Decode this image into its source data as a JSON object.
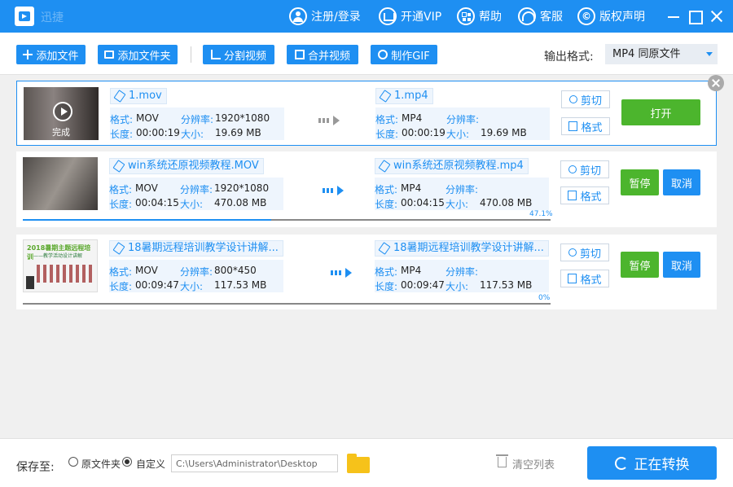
{
  "app": {
    "title": "迅捷"
  },
  "titlebar": {
    "items": [
      {
        "label": "注册/登录"
      },
      {
        "label": "开通VIP"
      },
      {
        "label": "帮助"
      },
      {
        "label": "客服"
      },
      {
        "label": "版权声明"
      }
    ]
  },
  "toolbar": {
    "add_file": "添加文件",
    "add_folder": "添加文件夹",
    "split_video": "分割视频",
    "merge_video": "合并视频",
    "make_gif": "制作GIF",
    "output_label": "输出格式:",
    "output_value": "MP4  同原文件"
  },
  "labels": {
    "format": "格式:",
    "resolution": "分辨率:",
    "duration": "长度:",
    "size": "大小:",
    "cut": "剪切",
    "format_btn": "格式",
    "done": "完成"
  },
  "files": [
    {
      "src_name": "1.mov",
      "src_format": "MOV",
      "src_resolution": "1920*1080",
      "src_duration": "00:00:19",
      "src_size": "19.69 MB",
      "dst_name": "1.mp4",
      "dst_format": "MP4",
      "dst_resolution": "",
      "dst_duration": "00:00:19",
      "dst_size": "19.69 MB",
      "status": "done",
      "action1": "打开"
    },
    {
      "src_name": "win系统还原视频教程.MOV",
      "src_format": "MOV",
      "src_resolution": "1920*1080",
      "src_duration": "00:04:15",
      "src_size": "470.08 MB",
      "dst_name": "win系统还原视频教程.mp4",
      "dst_format": "MP4",
      "dst_resolution": "",
      "dst_duration": "00:04:15",
      "dst_size": "470.08 MB",
      "status": "converting",
      "progress": 47.1,
      "progress_text": "47.1%",
      "action1": "暂停",
      "action2": "取消"
    },
    {
      "src_name": "18暑期远程培训教学设计讲解...",
      "src_format": "MOV",
      "src_resolution": "800*450",
      "src_duration": "00:09:47",
      "src_size": "117.53 MB",
      "dst_name": "18暑期远程培训教学设计讲解...",
      "dst_format": "MP4",
      "dst_resolution": "",
      "dst_duration": "00:09:47",
      "dst_size": "117.53 MB",
      "status": "pending",
      "progress": 0,
      "progress_text": "0%",
      "action1": "暂停",
      "action2": "取消",
      "thumb_title": "2018暑期主题远程培训",
      "thumb_sub": "——教学活动设计讲解"
    }
  ],
  "bottom": {
    "save_to": "保存至:",
    "original_folder": "原文件夹",
    "custom": "自定义",
    "path": "C:\\Users\\Administrator\\Desktop",
    "clear_list": "清空列表",
    "converting": "正在转换"
  },
  "colors": {
    "accent": "#1e8ff2",
    "green": "#4cb52d"
  }
}
